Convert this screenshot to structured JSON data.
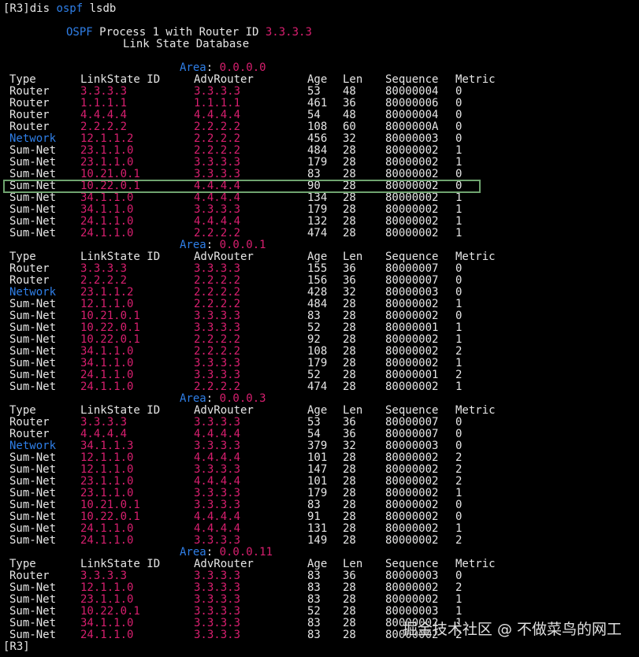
{
  "terminal": {
    "command": {
      "prompt": "[R3]",
      "parts": [
        {
          "text": "dis ",
          "color": "w"
        },
        {
          "text": "ospf",
          "color": "b"
        },
        {
          "text": " lsdb",
          "color": "w"
        }
      ]
    },
    "header": {
      "title_parts": [
        {
          "text": "OSPF",
          "color": "b"
        },
        {
          "text": " Process 1 with Router ID ",
          "color": "w"
        },
        {
          "text": "3.3.3.3",
          "color": "m"
        }
      ],
      "subtitle": "Link State Database"
    },
    "area_label": "Area",
    "columns": {
      "type": "Type",
      "lsid": "LinkState ID",
      "adv": "AdvRouter",
      "age": "Age",
      "len": "Len",
      "seq": "Sequence",
      "metric": "Metric"
    },
    "areas": [
      {
        "id": "0.0.0.0",
        "rows": [
          [
            "Router",
            "3.3.3.3",
            "3.3.3.3",
            "53",
            "48",
            "80000004",
            "0"
          ],
          [
            "Router",
            "1.1.1.1",
            "1.1.1.1",
            "461",
            "36",
            "80000006",
            "0"
          ],
          [
            "Router",
            "4.4.4.4",
            "4.4.4.4",
            "54",
            "48",
            "80000004",
            "0"
          ],
          [
            "Router",
            "2.2.2.2",
            "2.2.2.2",
            "108",
            "60",
            "8000000A",
            "0"
          ],
          [
            "Network",
            "12.1.1.2",
            "2.2.2.2",
            "456",
            "32",
            "80000003",
            "0"
          ],
          [
            "Sum-Net",
            "23.1.1.0",
            "2.2.2.2",
            "484",
            "28",
            "80000002",
            "1"
          ],
          [
            "Sum-Net",
            "23.1.1.0",
            "3.3.3.3",
            "179",
            "28",
            "80000002",
            "1"
          ],
          [
            "Sum-Net",
            "10.21.0.1",
            "3.3.3.3",
            "83",
            "28",
            "80000002",
            "0"
          ],
          [
            "Sum-Net",
            "10.22.0.1",
            "4.4.4.4",
            "90",
            "28",
            "80000002",
            "0"
          ],
          [
            "Sum-Net",
            "34.1.1.0",
            "4.4.4.4",
            "134",
            "28",
            "80000002",
            "1"
          ],
          [
            "Sum-Net",
            "34.1.1.0",
            "3.3.3.3",
            "179",
            "28",
            "80000002",
            "1"
          ],
          [
            "Sum-Net",
            "24.1.1.0",
            "4.4.4.4",
            "132",
            "28",
            "80000002",
            "1"
          ],
          [
            "Sum-Net",
            "24.1.1.0",
            "2.2.2.2",
            "474",
            "28",
            "80000002",
            "1"
          ]
        ]
      },
      {
        "id": "0.0.0.1",
        "rows": [
          [
            "Router",
            "3.3.3.3",
            "3.3.3.3",
            "155",
            "36",
            "80000007",
            "0"
          ],
          [
            "Router",
            "2.2.2.2",
            "2.2.2.2",
            "156",
            "36",
            "80000007",
            "0"
          ],
          [
            "Network",
            "23.1.1.2",
            "2.2.2.2",
            "428",
            "32",
            "80000003",
            "0"
          ],
          [
            "Sum-Net",
            "12.1.1.0",
            "2.2.2.2",
            "484",
            "28",
            "80000002",
            "1"
          ],
          [
            "Sum-Net",
            "10.21.0.1",
            "3.3.3.3",
            "83",
            "28",
            "80000002",
            "0"
          ],
          [
            "Sum-Net",
            "10.22.0.1",
            "3.3.3.3",
            "52",
            "28",
            "80000001",
            "1"
          ],
          [
            "Sum-Net",
            "10.22.0.1",
            "2.2.2.2",
            "92",
            "28",
            "80000002",
            "1"
          ],
          [
            "Sum-Net",
            "34.1.1.0",
            "2.2.2.2",
            "108",
            "28",
            "80000002",
            "2"
          ],
          [
            "Sum-Net",
            "34.1.1.0",
            "3.3.3.3",
            "179",
            "28",
            "80000002",
            "1"
          ],
          [
            "Sum-Net",
            "24.1.1.0",
            "3.3.3.3",
            "52",
            "28",
            "80000001",
            "2"
          ],
          [
            "Sum-Net",
            "24.1.1.0",
            "2.2.2.2",
            "474",
            "28",
            "80000002",
            "1"
          ]
        ]
      },
      {
        "id": "0.0.0.3",
        "rows": [
          [
            "Router",
            "3.3.3.3",
            "3.3.3.3",
            "53",
            "36",
            "80000007",
            "0"
          ],
          [
            "Router",
            "4.4.4.4",
            "4.4.4.4",
            "54",
            "36",
            "80000007",
            "0"
          ],
          [
            "Network",
            "34.1.1.3",
            "3.3.3.3",
            "379",
            "32",
            "80000003",
            "0"
          ],
          [
            "Sum-Net",
            "12.1.1.0",
            "4.4.4.4",
            "101",
            "28",
            "80000002",
            "2"
          ],
          [
            "Sum-Net",
            "12.1.1.0",
            "3.3.3.3",
            "147",
            "28",
            "80000002",
            "2"
          ],
          [
            "Sum-Net",
            "23.1.1.0",
            "4.4.4.4",
            "101",
            "28",
            "80000002",
            "2"
          ],
          [
            "Sum-Net",
            "23.1.1.0",
            "3.3.3.3",
            "179",
            "28",
            "80000002",
            "1"
          ],
          [
            "Sum-Net",
            "10.21.0.1",
            "3.3.3.3",
            "83",
            "28",
            "80000002",
            "0"
          ],
          [
            "Sum-Net",
            "10.22.0.1",
            "4.4.4.4",
            "91",
            "28",
            "80000002",
            "0"
          ],
          [
            "Sum-Net",
            "24.1.1.0",
            "4.4.4.4",
            "131",
            "28",
            "80000002",
            "1"
          ],
          [
            "Sum-Net",
            "24.1.1.0",
            "3.3.3.3",
            "149",
            "28",
            "80000002",
            "2"
          ]
        ]
      },
      {
        "id": "0.0.0.11",
        "rows": [
          [
            "Router",
            "3.3.3.3",
            "3.3.3.3",
            "83",
            "36",
            "80000003",
            "0"
          ],
          [
            "Sum-Net",
            "12.1.1.0",
            "3.3.3.3",
            "83",
            "28",
            "80000002",
            "2"
          ],
          [
            "Sum-Net",
            "23.1.1.0",
            "3.3.3.3",
            "83",
            "28",
            "80000002",
            "1"
          ],
          [
            "Sum-Net",
            "10.22.0.1",
            "3.3.3.3",
            "52",
            "28",
            "80000003",
            "1"
          ],
          [
            "Sum-Net",
            "34.1.1.0",
            "3.3.3.3",
            "83",
            "28",
            "80000002",
            "1"
          ],
          [
            "Sum-Net",
            "24.1.1.0",
            "3.3.3.3",
            "83",
            "28",
            "80000002",
            "2"
          ]
        ]
      }
    ],
    "end_prompt": "[R3]",
    "highlight_row": {
      "area": 0,
      "row": 8
    },
    "colors": {
      "default": "#e6e6e6",
      "keyword": "#2f7fe8",
      "value": "#d81f6f",
      "highlight_border": "#6fa46f",
      "background": "#000000"
    }
  },
  "watermark": "掘金技术社区 @ 不做菜鸟的网工"
}
